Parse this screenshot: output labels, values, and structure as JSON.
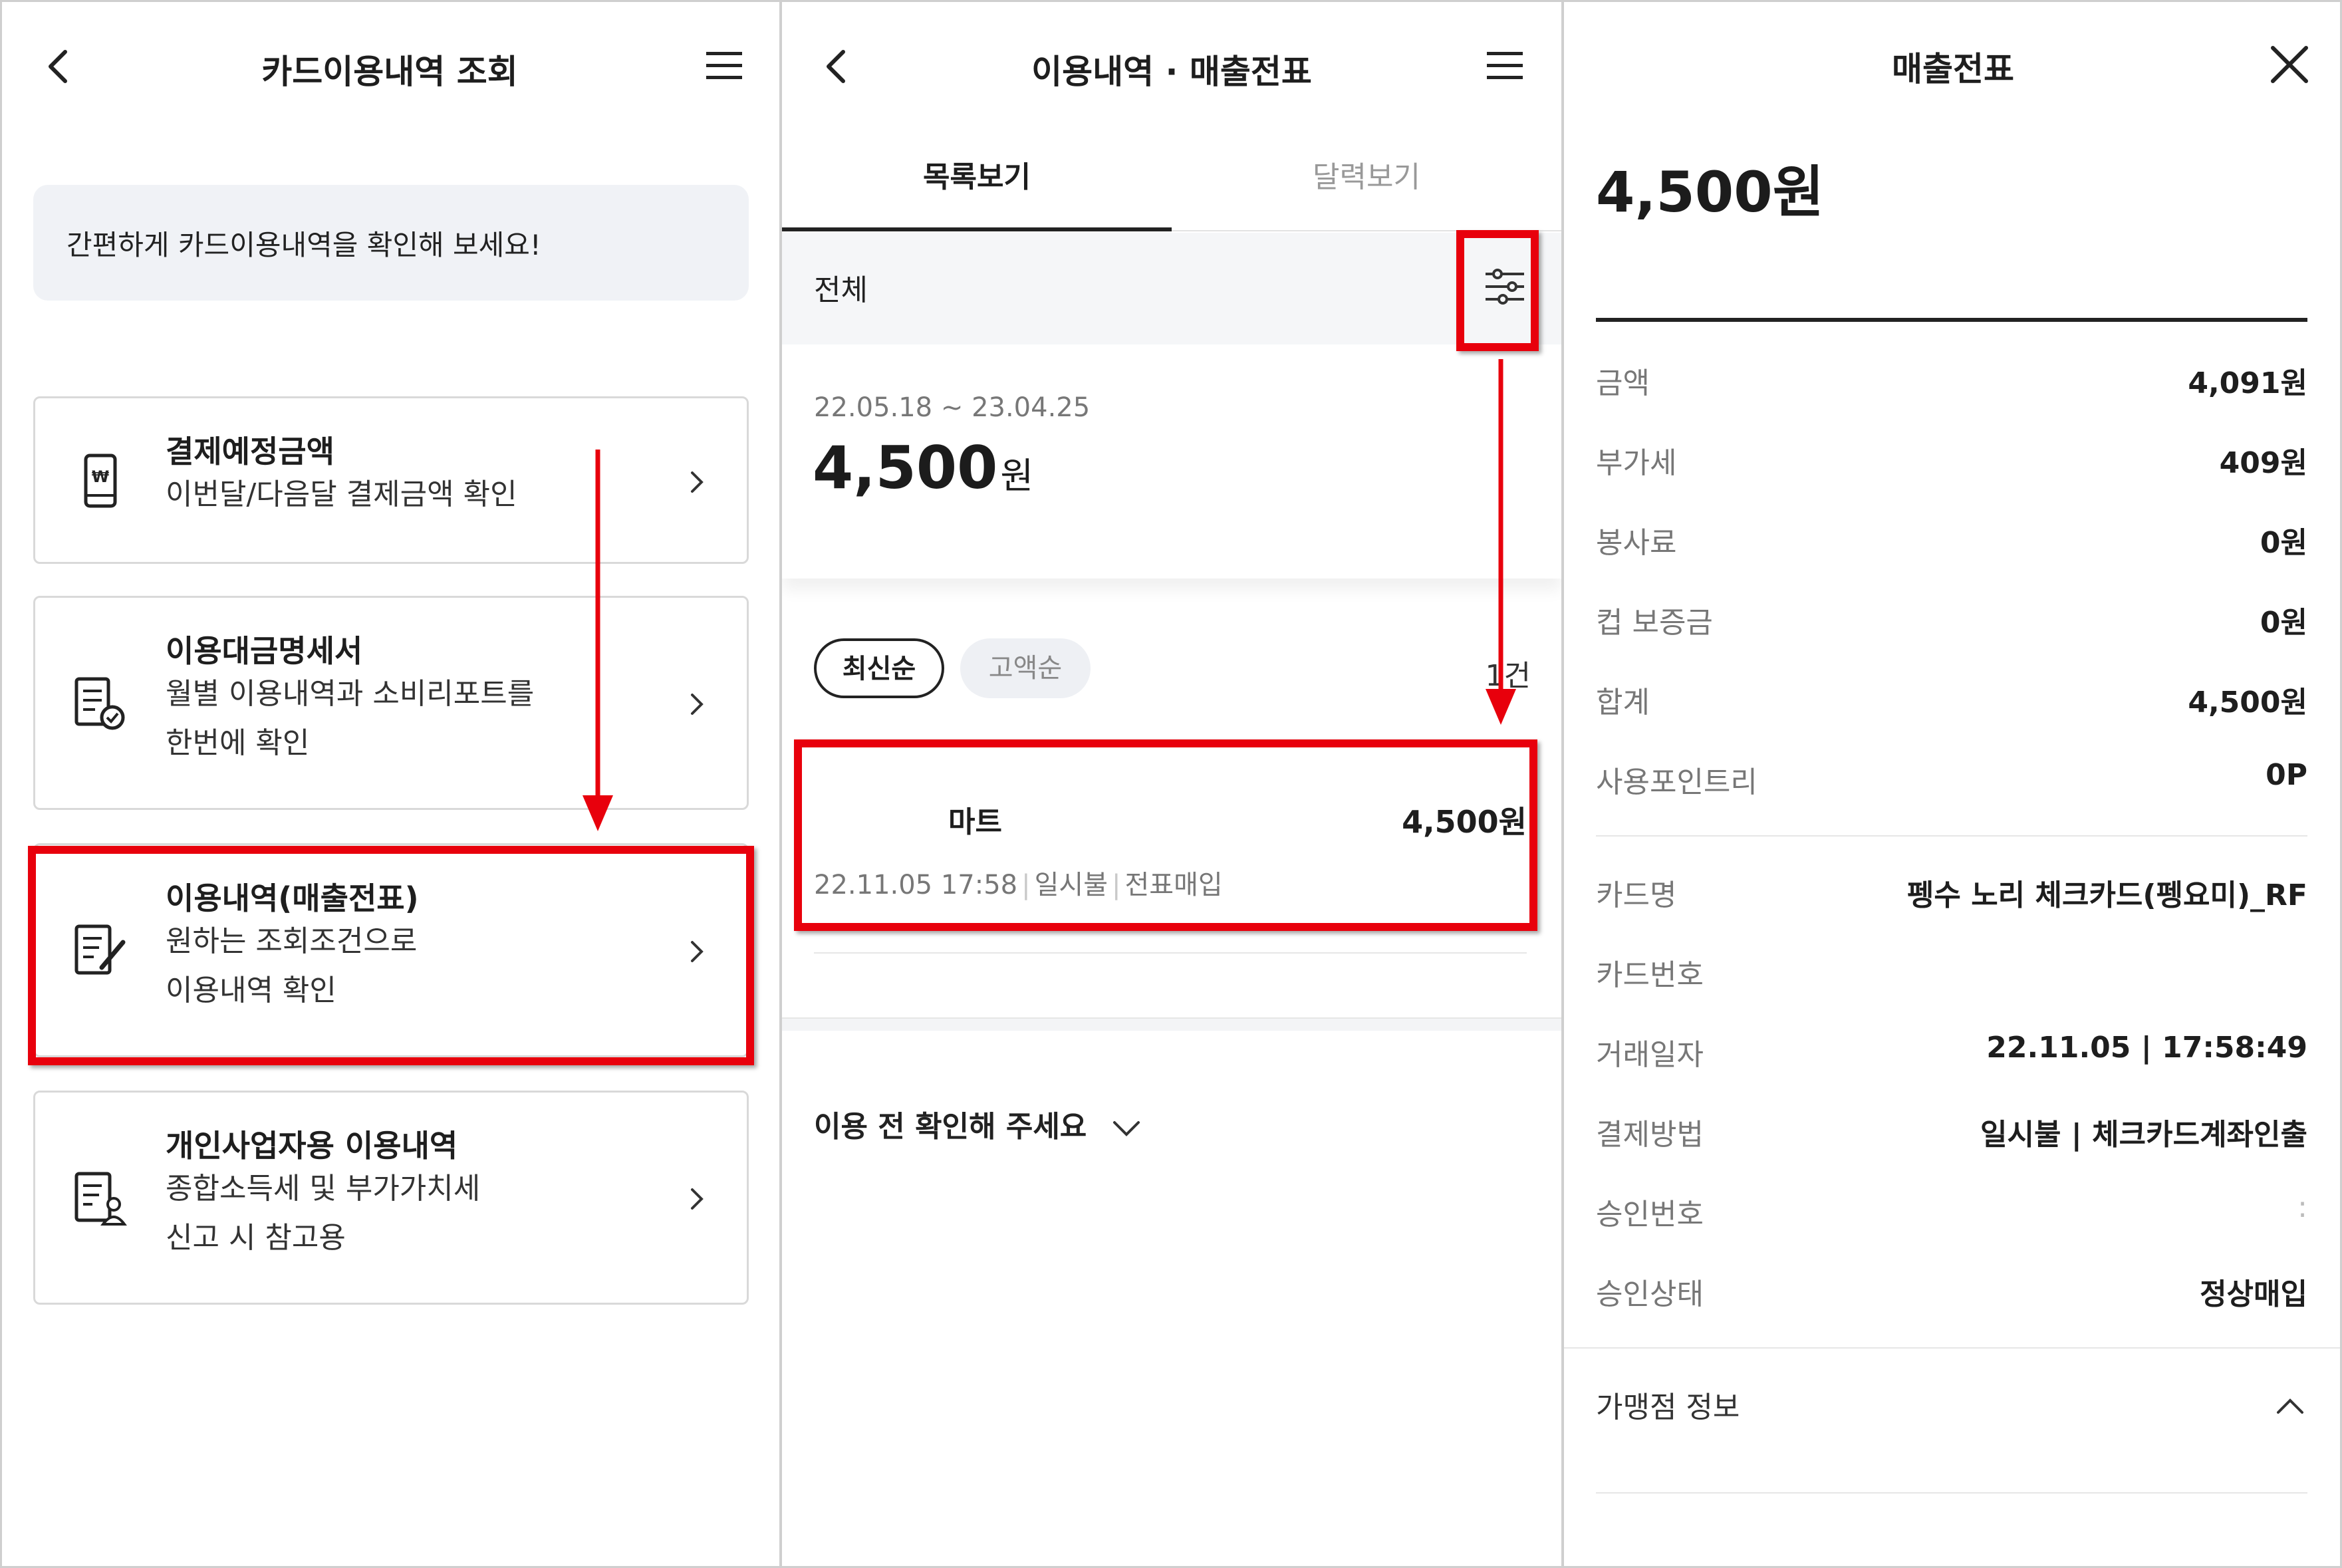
{
  "screen1": {
    "title": "카드이용내역 조회",
    "notice": "간편하게 카드이용내역을 확인해 보세요!",
    "cards": [
      {
        "title": "결제예정금액",
        "subtitle_lines": [
          "이번달/다음달 결제금액 확인"
        ],
        "icon": "won-phone-icon"
      },
      {
        "title": "이용대금명세서",
        "subtitle_lines": [
          "월별 이용내역과 소비리포트를",
          "한번에 확인"
        ],
        "icon": "statement-check-icon"
      },
      {
        "title": "이용내역(매출전표)",
        "subtitle_lines": [
          "원하는 조회조건으로",
          "이용내역 확인"
        ],
        "icon": "document-edit-icon",
        "highlighted": true
      },
      {
        "title": "개인사업자용 이용내역",
        "subtitle_lines": [
          "종합소득세 및 부가가치세",
          "신고 시 참고용"
        ],
        "icon": "document-person-icon"
      }
    ]
  },
  "screen2": {
    "title": "이용내역 · 매출전표",
    "tabs": [
      {
        "label": "목록보기",
        "active": true
      },
      {
        "label": "달력보기",
        "active": false
      }
    ],
    "filter_label": "전체",
    "period": "22.05.18 ~ 23.04.25",
    "total_amount": "4,500",
    "total_unit": "원",
    "sort_options": [
      {
        "label": "최신순",
        "active": true
      },
      {
        "label": "고액순",
        "active": false
      }
    ],
    "count": "1건",
    "transaction": {
      "merchant": "마트",
      "amount": "4,500원",
      "datetime": "22.11.05 17:58",
      "installment": "일시불",
      "type": "전표매입"
    },
    "check_notice": "이용 전 확인해 주세요"
  },
  "screen3": {
    "title": "매출전표",
    "amount": "4,500원",
    "amount_rows": [
      {
        "label": "금액",
        "value": "4,091원"
      },
      {
        "label": "부가세",
        "value": "409원"
      },
      {
        "label": "봉사료",
        "value": "0원"
      },
      {
        "label": "컵 보증금",
        "value": "0원"
      },
      {
        "label": "합계",
        "value": "4,500원"
      },
      {
        "label": "사용포인트리",
        "value": "0P"
      }
    ],
    "detail_rows": [
      {
        "label": "카드명",
        "value": "펭수 노리 체크카드(펭요미)_RF"
      },
      {
        "label": "카드번호",
        "value": ""
      },
      {
        "label": "거래일자",
        "value": "22.11.05 | 17:58:49"
      },
      {
        "label": "결제방법",
        "value": "일시불 | 체크카드계좌인출"
      },
      {
        "label": "승인번호",
        "value": ":"
      },
      {
        "label": "승인상태",
        "value": "정상매입"
      }
    ],
    "merchant_section": "가맹점 정보"
  },
  "colors": {
    "highlight": "#e8000c",
    "accent_text": "#1e1e1e",
    "muted_text": "#777777",
    "pill_bg": "#eef0f4"
  },
  "icons": [
    "back-icon",
    "menu-icon",
    "close-icon",
    "chevron-right-icon",
    "filter-icon",
    "chevron-down-icon",
    "chevron-up-icon"
  ]
}
